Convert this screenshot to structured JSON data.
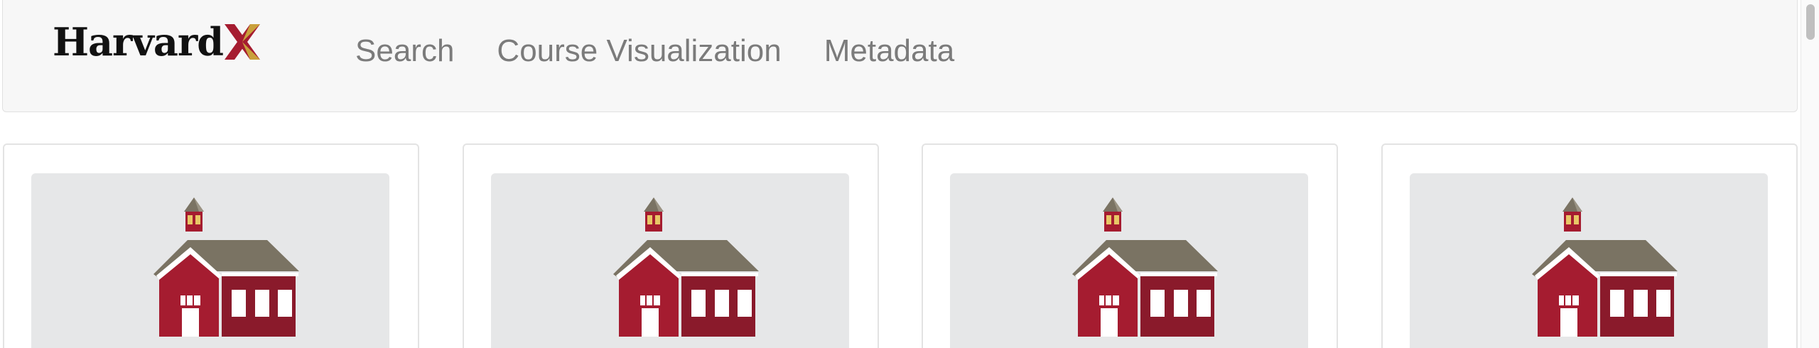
{
  "brand": {
    "text": "Harvard",
    "x_icon": "harvardx-x-logo",
    "x_colors": [
      "#a51c30",
      "#c9a03b"
    ]
  },
  "nav": {
    "items": [
      {
        "label": "Search"
      },
      {
        "label": "Course Visualization"
      },
      {
        "label": "Metadata"
      }
    ]
  },
  "cards": [
    {
      "image_icon": "schoolhouse-icon"
    },
    {
      "image_icon": "schoolhouse-icon"
    },
    {
      "image_icon": "schoolhouse-icon"
    },
    {
      "image_icon": "schoolhouse-icon"
    }
  ],
  "colors": {
    "navbar_bg": "#f7f7f7",
    "nav_text": "#7b7b7b",
    "school_red": "#a51c30",
    "school_dark_red": "#8a1a2b",
    "roof": "#7a7363",
    "thumb_bg": "#e6e7e8"
  }
}
